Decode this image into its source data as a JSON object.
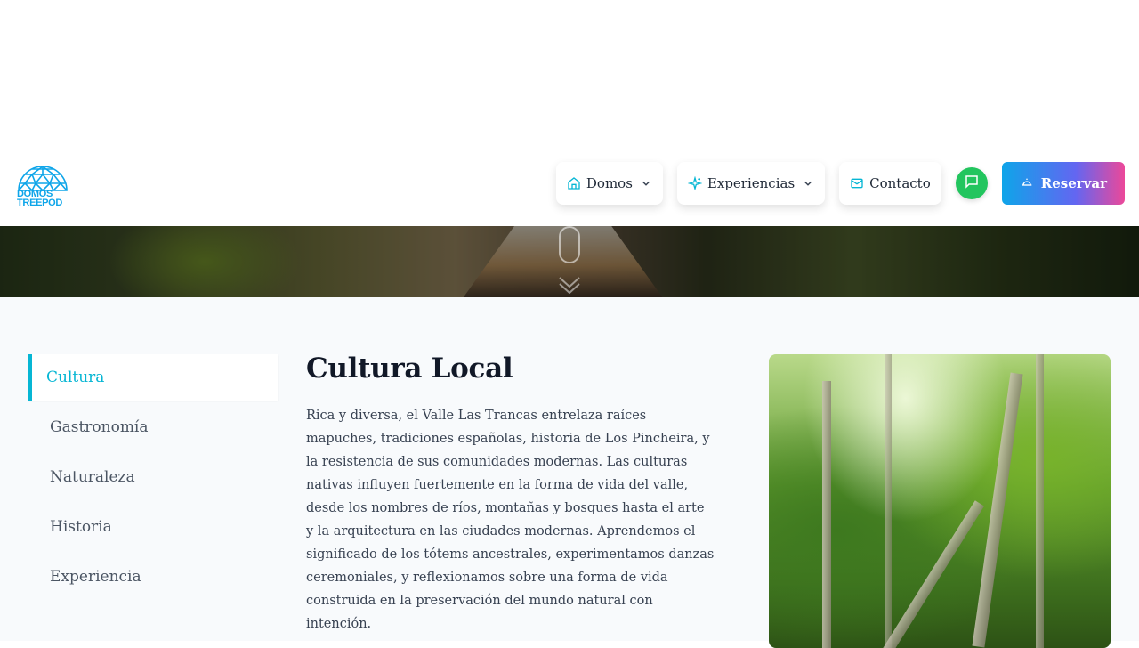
{
  "header": {
    "logo": {
      "icon": "dome-logo-icon",
      "line1": "DOMOS",
      "line2": "TREEPOD",
      "color": "#0ea5e9"
    },
    "nav": {
      "domos": {
        "label": "Domos",
        "icon": "home-icon"
      },
      "experiencias": {
        "label": "Experiencias",
        "icon": "sparkles-icon"
      },
      "contacto": {
        "label": "Contacto",
        "icon": "mail-icon"
      },
      "chat": {
        "icon": "chat-icon",
        "color": "#22c55e"
      },
      "reservar": {
        "label": "Reservar",
        "icon": "bell-icon"
      }
    }
  },
  "hero": {
    "scroll_icon": "mouse-scroll-icon"
  },
  "sidebar": {
    "items": [
      {
        "label": "Cultura",
        "active": true
      },
      {
        "label": "Gastronomía",
        "active": false
      },
      {
        "label": "Naturaleza",
        "active": false
      },
      {
        "label": "Historia",
        "active": false
      },
      {
        "label": "Experiencia",
        "active": false
      }
    ],
    "accent": "#06b6d4"
  },
  "content": {
    "title": "Cultura Local",
    "body": "Rica y diversa, el Valle Las Trancas entrelaza raíces mapuches, tradiciones españolas, historia de Los Pincheira, y la resistencia de sus comunidades modernas. Las culturas nativas influyen fuertemente en la forma de vida del valle, desde los nombres de ríos, montañas y bosques hasta el arte y la arquitectura en las ciudades modernas. Aprendemos el significado de los tótems ancestrales, experimentamos danzas ceremoniales, y reflexionamos sobre una forma de vida construida en la preservación del mundo natural con intención."
  }
}
